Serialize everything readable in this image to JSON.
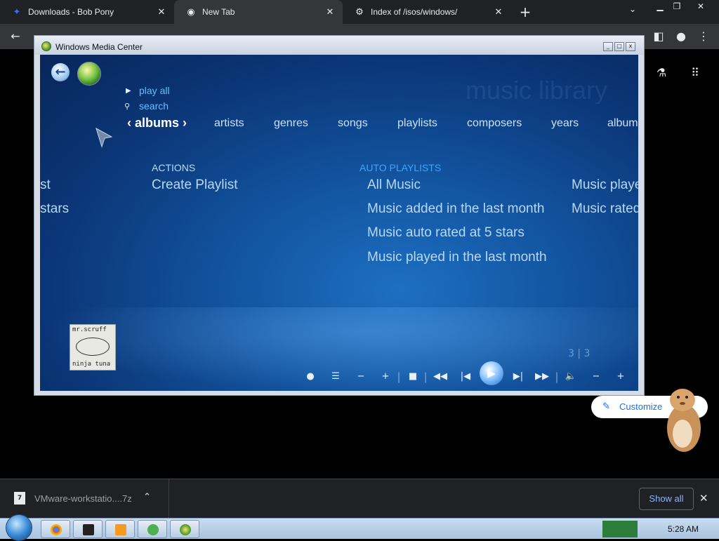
{
  "browser": {
    "tabs": [
      {
        "title": "Downloads - Bob Pony",
        "close": "✕"
      },
      {
        "title": "New Tab",
        "close": "✕"
      },
      {
        "title": "Index of /isos/windows/",
        "close": "✕"
      }
    ],
    "new_tab": "+",
    "tab_menu": "⌄"
  },
  "wmc": {
    "window_title": "Windows Media Center",
    "menu": [
      {
        "label": "play all"
      },
      {
        "label": "search"
      }
    ],
    "watermark": "music library",
    "categories": [
      "albums",
      "artists",
      "genres",
      "songs",
      "playlists",
      "composers",
      "years",
      "album"
    ],
    "actions_label": "ACTIONS",
    "actions": [
      "Create Playlist"
    ],
    "auto_label": "AUTO PLAYLISTS",
    "auto_items": [
      "All Music",
      "Music added in the last month",
      "Music auto rated at 5 stars",
      "Music played in the last month"
    ],
    "right_items": [
      "Music played",
      "Music rated"
    ],
    "left_partial": [
      "st",
      "stars"
    ],
    "album_art": {
      "line1": "mr.scruff",
      "line2": "ninja tuna"
    },
    "pager": "3 | 3"
  },
  "customize": {
    "label": "Customize"
  },
  "downloads": {
    "file": "VMware-workstatio....7z",
    "show_all": "Show all"
  },
  "taskbar": {
    "clock": "5:28 AM"
  }
}
